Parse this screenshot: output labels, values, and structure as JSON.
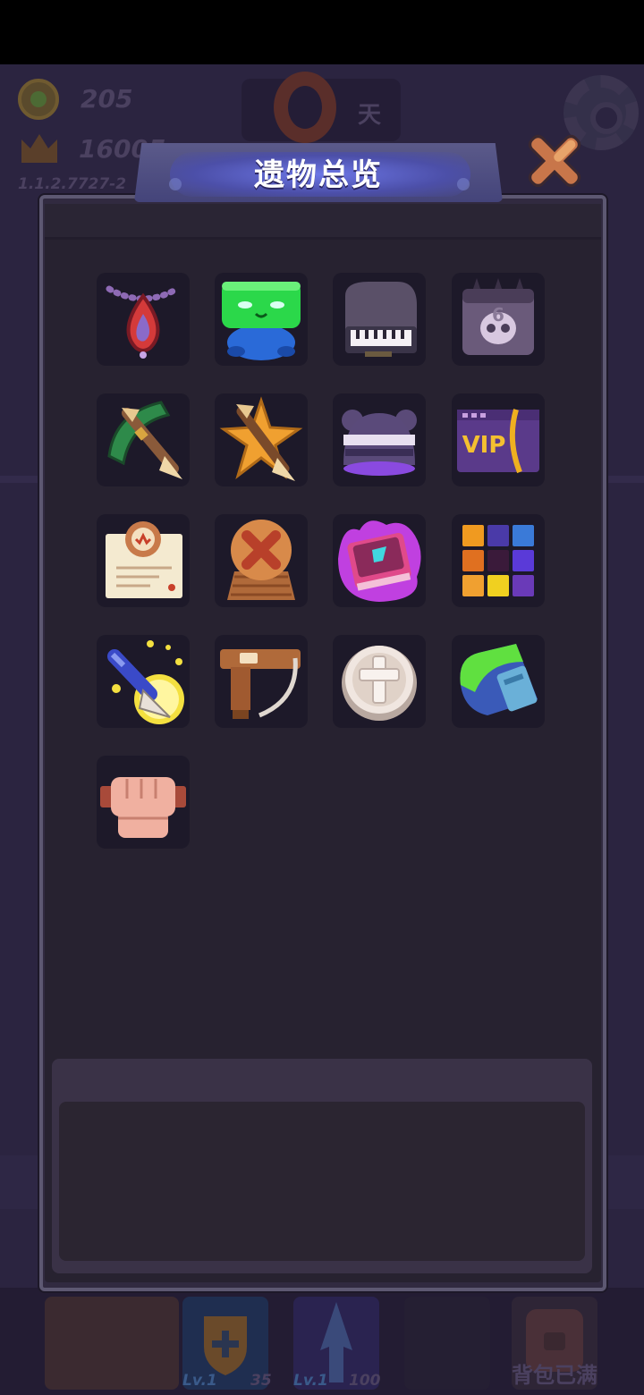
{
  "hud": {
    "coins": "205",
    "score": "16005",
    "version": "1.1.2.7727-2",
    "day_label": "天"
  },
  "modal": {
    "title": "遗物总览",
    "description": ""
  },
  "relics": [
    {
      "icon": "fire-amulet-icon"
    },
    {
      "icon": "green-slime-frog-icon"
    },
    {
      "icon": "grand-piano-icon"
    },
    {
      "icon": "skull-calendar-icon"
    },
    {
      "icon": "jade-crossbow-icon"
    },
    {
      "icon": "star-crossbow-icon"
    },
    {
      "icon": "purple-helmet-icon"
    },
    {
      "icon": "vip-card-icon"
    },
    {
      "icon": "certificate-scroll-icon"
    },
    {
      "icon": "cancel-token-icon"
    },
    {
      "icon": "cursed-book-icon"
    },
    {
      "icon": "color-grid-icon"
    },
    {
      "icon": "golden-arrow-icon"
    },
    {
      "icon": "wooden-trigger-icon"
    },
    {
      "icon": "holy-cross-coin-icon"
    },
    {
      "icon": "slime-gauntlet-icon"
    },
    {
      "icon": "fist-glove-icon"
    }
  ],
  "bottom_bar": {
    "slot1_level": "Lv.1",
    "slot1_value": "35",
    "slot2_level": "Lv.1",
    "slot2_value": "100",
    "bag_status": "背包已满"
  },
  "colors": {
    "modal_bg": "#272230",
    "relic_bg": "#1d1929",
    "title_banner": "#4c4fa8",
    "close_orange": "#e58a3c"
  }
}
